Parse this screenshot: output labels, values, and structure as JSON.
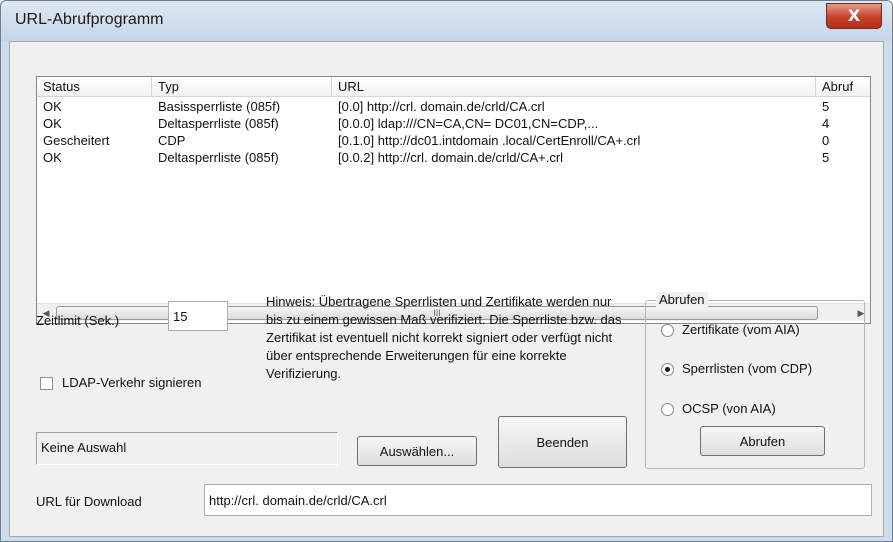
{
  "window": {
    "title": "URL-Abrufprogramm",
    "close_symbol": "X"
  },
  "list": {
    "columns": [
      "Status",
      "Typ",
      "URL",
      "Abruf"
    ],
    "rows": [
      {
        "status": "OK",
        "typ": "Basissperrliste (085f)",
        "url": "[0.0] http://crl. domain.de/crld/CA.crl",
        "abruf": "5"
      },
      {
        "status": "OK",
        "typ": "Deltasperrliste (085f)",
        "url": "[0.0.0] ldap:///CN=CA,CN= DC01,CN=CDP,...",
        "abruf": "4"
      },
      {
        "status": "Gescheitert",
        "typ": "CDP",
        "url": "[0.1.0] http://dc01.intdomain .local/CertEnroll/CA+.crl",
        "abruf": "0"
      },
      {
        "status": "OK",
        "typ": "Deltasperrliste (085f)",
        "url": "[0.0.2] http://crl. domain.de/crld/CA+.crl",
        "abruf": "5"
      }
    ],
    "scroll_left": "◀",
    "scroll_right": "▶",
    "thumb_grip": "III"
  },
  "timeout": {
    "label": "Zeitlimit (Sek.)",
    "value": "15"
  },
  "ldap": {
    "label": "LDAP-Verkehr signieren",
    "checked": false
  },
  "hint": "Hinweis: Übertragene Sperrlisten und Zertifikate werden nur bis zu einem gewissen Maß verifiziert. Die Sperrliste bzw. das Zertifikat ist eventuell nicht korrekt signiert oder verfügt nicht über entsprechende Erweiterungen für eine korrekte Verifizierung.",
  "selection": {
    "status": "Keine Auswahl"
  },
  "buttons": {
    "select": "Auswählen...",
    "close": "Beenden",
    "fetch": "Abrufen"
  },
  "fetch_group": {
    "title": "Abrufen",
    "options": [
      {
        "label": "Zertifikate (vom AIA)",
        "selected": false
      },
      {
        "label": "Sperrlisten (vom CDP)",
        "selected": true
      },
      {
        "label": "OCSP (von AIA)",
        "selected": false
      }
    ]
  },
  "download": {
    "label": "URL für Download",
    "value": "http://crl. domain.de/crld/CA.crl"
  }
}
